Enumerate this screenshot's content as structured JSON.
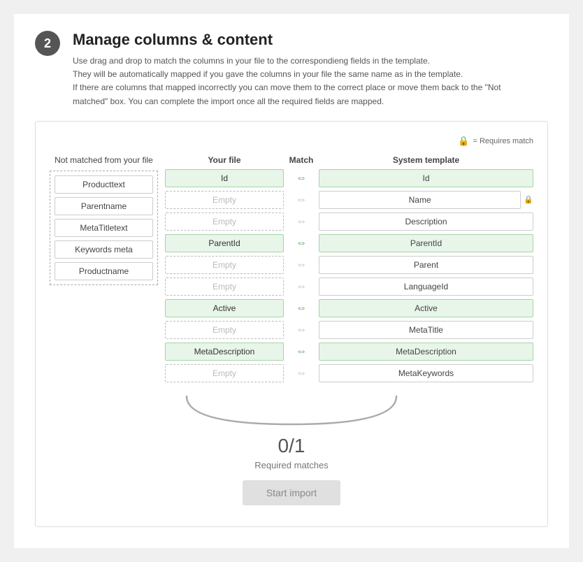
{
  "step": {
    "number": "2",
    "title": "Manage columns & content",
    "description_lines": [
      "Use drag and drop to match the columns in your file to the correspondieng fields in the template.",
      "They will be automatically mapped if you gave the columns in your file the same name as in the template.",
      "If there are columns that mapped incorrectly you can move them to the correct place or move them back to the \"Not",
      "matched\" box. You can complete the import once all the required fields are mapped."
    ]
  },
  "requires_match_label": "= Requires match",
  "not_matched_panel": {
    "title": "Not matched from your file",
    "chips": [
      "Producttext",
      "Parentname",
      "MetaTitletext",
      "Keywords meta",
      "Productname"
    ]
  },
  "mapping": {
    "col_your_file": "Your file",
    "col_match": "Match",
    "col_system": "System template",
    "rows": [
      {
        "file": "Id",
        "matched": true,
        "system": "Id",
        "requires": false
      },
      {
        "file": "Empty",
        "matched": false,
        "system": "Name",
        "requires": true
      },
      {
        "file": "Empty",
        "matched": false,
        "system": "Description",
        "requires": false
      },
      {
        "file": "ParentId",
        "matched": true,
        "system": "ParentId",
        "requires": false
      },
      {
        "file": "Empty",
        "matched": false,
        "system": "Parent",
        "requires": false
      },
      {
        "file": "Empty",
        "matched": false,
        "system": "LanguageId",
        "requires": false
      },
      {
        "file": "Active",
        "matched": true,
        "system": "Active",
        "requires": false
      },
      {
        "file": "Empty",
        "matched": false,
        "system": "MetaTitle",
        "requires": false
      },
      {
        "file": "MetaDescription",
        "matched": true,
        "system": "MetaDescription",
        "requires": false
      },
      {
        "file": "Empty",
        "matched": false,
        "system": "MetaKeywords",
        "requires": false
      }
    ]
  },
  "counter": {
    "value": "0/1",
    "label": "Required matches"
  },
  "start_import_btn": "Start import"
}
